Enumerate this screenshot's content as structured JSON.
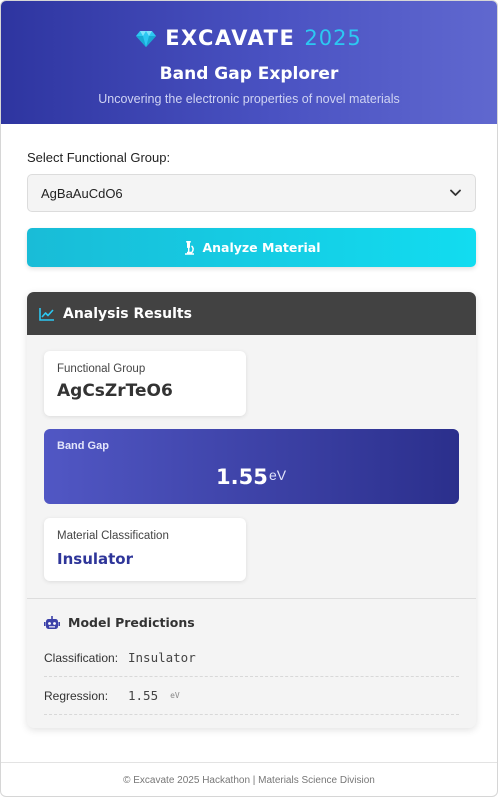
{
  "header": {
    "brand": "EXCAVATE",
    "year": "2025",
    "title": "Band Gap Explorer",
    "subtitle": "Uncovering the electronic properties of novel materials",
    "icon": "gem-icon"
  },
  "form": {
    "select_label": "Select Functional Group:",
    "selected_value": "AgBaAuCdO6",
    "analyze_label": "Analyze Material",
    "analyze_icon": "microscope-icon"
  },
  "results": {
    "title": "Analysis Results",
    "functional_group_label": "Functional Group",
    "functional_group_value": "AgCsZrTeO6",
    "band_gap_label": "Band Gap",
    "band_gap_value": "1.55",
    "band_gap_unit": "eV",
    "classification_label": "Material Classification",
    "classification_value": "Insulator"
  },
  "predictions": {
    "title": "Model Predictions",
    "classification_key": "Classification:",
    "classification_value": "Insulator",
    "regression_key": "Regression:",
    "regression_value": "1.55",
    "regression_unit": "eV"
  },
  "footer": {
    "text": "© Excavate 2025 Hackathon | Materials Science Division"
  },
  "colors": {
    "header_gradient_start": "#2e35a0",
    "header_gradient_end": "#6068cf",
    "accent_cyan": "#12dcf0",
    "results_header": "#424242",
    "classification_text": "#2e3599"
  }
}
